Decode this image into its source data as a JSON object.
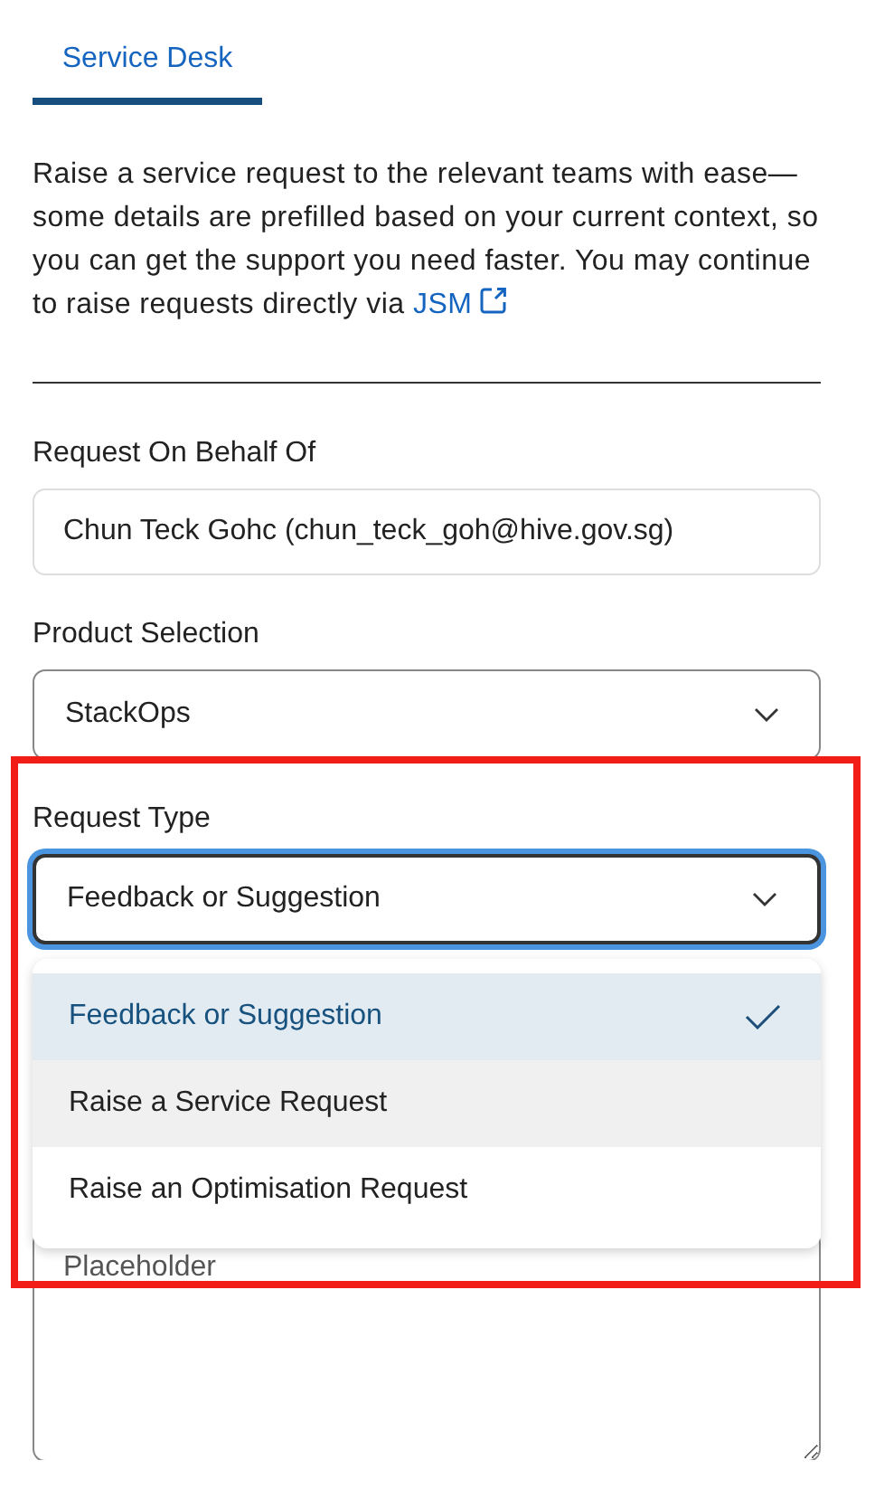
{
  "tabs": [
    {
      "label": "Service Desk",
      "selected": true
    }
  ],
  "intro": {
    "text": "Raise a service request to the relevant teams with ease—some details are prefilled based on your current context, so you can get the support you need faster. You may continue to raise requests directly via",
    "link": "JSM"
  },
  "fields": [
    {
      "kind": "input",
      "label": "Request On Behalf Of",
      "value": "Chun Teck Gohc (chun_teck_goh@hive.gov.sg)"
    },
    {
      "kind": "select",
      "label": "Product Selection",
      "value": "StackOps",
      "focused": false
    },
    {
      "kind": "select",
      "label": "Request Type",
      "value": "Feedback or Suggestion",
      "focused": true,
      "expanded": true,
      "options": [
        {
          "label": "Feedback or Suggestion",
          "selected": true,
          "hovered": false
        },
        {
          "label": "Raise a Service Request",
          "selected": false,
          "hovered": true
        },
        {
          "label": "Raise an Optimisation Request",
          "selected": false,
          "hovered": false
        }
      ]
    },
    {
      "kind": "textarea",
      "placeholder": "Placeholder"
    }
  ]
}
